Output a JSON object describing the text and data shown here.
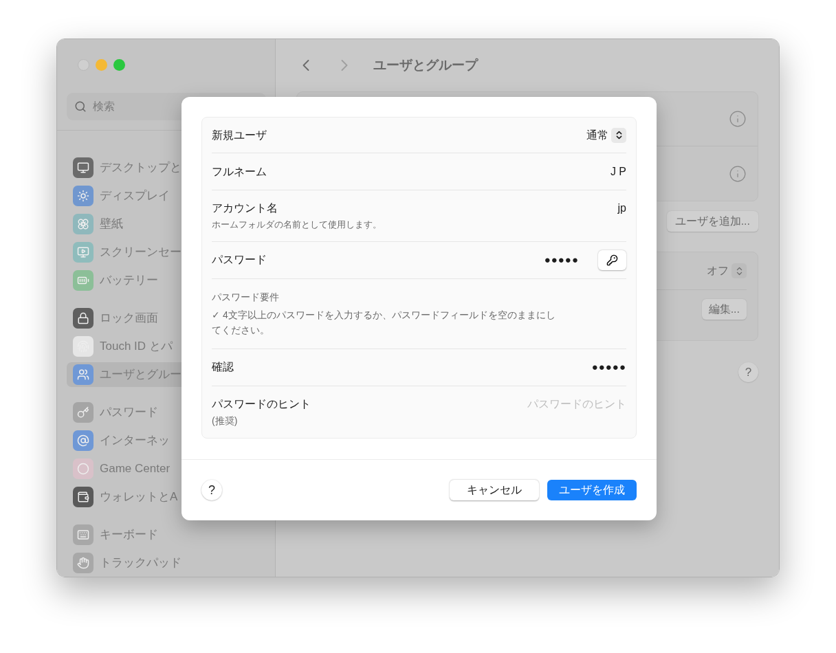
{
  "window": {
    "title": "ユーザとグループ",
    "nav": [
      {
        "kind": "back",
        "disabled": false
      },
      {
        "kind": "forward",
        "disabled": true
      }
    ]
  },
  "sidebar": {
    "search": {
      "placeholder": "検索"
    },
    "groups": [
      {
        "items": [
          {
            "label": "デスクトップと",
            "selected": false
          },
          {
            "label": "ディスプレイ",
            "selected": false
          },
          {
            "label": "壁紙",
            "selected": false
          },
          {
            "label": "スクリーンセー",
            "selected": false
          },
          {
            "label": "バッテリー",
            "selected": false
          }
        ]
      },
      {
        "items": [
          {
            "label": "ロック画面",
            "selected": false
          },
          {
            "label": "Touch ID とパ",
            "selected": false
          },
          {
            "label": "ユーザとグルー",
            "selected": true
          }
        ]
      },
      {
        "items": [
          {
            "label": "パスワード",
            "selected": false
          },
          {
            "label": "インターネッ",
            "selected": false
          },
          {
            "label": "Game Center",
            "selected": false
          },
          {
            "label": "ウォレットとA",
            "selected": false
          }
        ]
      },
      {
        "items": [
          {
            "label": "キーボード",
            "selected": false
          },
          {
            "label": "トラックパッド",
            "selected": false
          }
        ]
      }
    ]
  },
  "main": {
    "add_user_button": "ユーザを追加...",
    "auto_login": {
      "value": "オフ"
    },
    "edit_button": "編集...",
    "help": "?"
  },
  "dialog": {
    "rows": [
      {
        "kind": "select",
        "label": "新規ユーザ",
        "value": "通常"
      },
      {
        "kind": "text",
        "label": "フルネーム",
        "value": "J P"
      },
      {
        "kind": "text",
        "label": "アカウント名",
        "value": "jp",
        "note": "ホームフォルダの名前として使用します。"
      },
      {
        "kind": "password",
        "label": "パスワード",
        "value": "●●●●●"
      },
      {
        "kind": "requirements",
        "title": "パスワード要件",
        "text": "✓ 4文字以上のパスワードを入力するか、パスワードフィールドを空のままにしてください。"
      },
      {
        "kind": "confirm",
        "label": "確認",
        "value": "●●●●●"
      },
      {
        "kind": "hint",
        "label": "パスワードのヒント",
        "note": "(推奨)",
        "placeholder": "パスワードのヒント"
      }
    ],
    "help": "?",
    "buttons": [
      {
        "kind": "secondary",
        "label": "キャンセル"
      },
      {
        "kind": "primary",
        "label": "ユーザを作成"
      }
    ]
  }
}
